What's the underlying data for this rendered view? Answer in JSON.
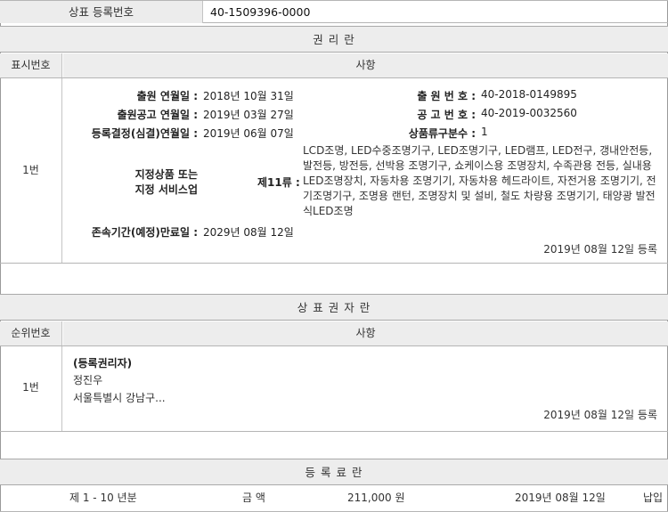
{
  "header": {
    "label": "상표 등록번호",
    "value": "40-1509396-0000"
  },
  "rights_section": {
    "title": "권 리 란",
    "col_num": "표시번호",
    "col_content": "사항",
    "entry": {
      "num": "1번",
      "filing_date_label": "출원 연월일 :",
      "filing_date": "2018년 10월 31일",
      "filing_no_label": "출 원 번 호 :",
      "filing_no": "40-2018-0149895",
      "pub_date_label": "출원공고 연월일 :",
      "pub_date": "2019년 03월 27일",
      "pub_no_label": "공 고 번 호 :",
      "pub_no": "40-2019-0032560",
      "decision_label": "등록결정(심결)연월일 :",
      "decision_date": "2019년 06월 07일",
      "class_count_label": "상품류구분수 :",
      "class_count": "1",
      "goods_label_line1": "지정상품 또는",
      "goods_label_line2": "지정 서비스업",
      "class_label": "제11류 :",
      "goods_text": "LCD조명, LED수중조명기구, LED조명기구, LED램프, LED전구, 갱내안전등, 발전등, 방전등, 선박용 조명기구, 쇼케이스용 조명장치, 수족관용 전등, 실내용LED조명장치, 자동차용 조명기기, 자동차용 헤드라이트, 자전거용 조명기기, 전기조명기구, 조명용 랜턴, 조명장치 및 설비, 철도 차량용 조명기기, 태양광 발전식LED조명",
      "expiry_label": "존속기간(예정)만료일 :",
      "expiry_date": "2029년 08월 12일",
      "registered_note": "2019년 08월 12일 등록"
    }
  },
  "owner_section": {
    "title": "상 표 권 자 란",
    "col_num": "순위번호",
    "col_content": "사항",
    "entry": {
      "num": "1번",
      "role": "(등록권리자)",
      "name": "정진우",
      "address": "서울특별시 강남구...",
      "registered_note": "2019년 08월 12일 등록"
    }
  },
  "fee_section": {
    "title": "등 록 료 란",
    "row": {
      "period": "제 1 - 10 년분",
      "amount_label": "금 액",
      "amount": "211,000 원",
      "date": "2019년 08월 12일",
      "status": "납입"
    }
  }
}
